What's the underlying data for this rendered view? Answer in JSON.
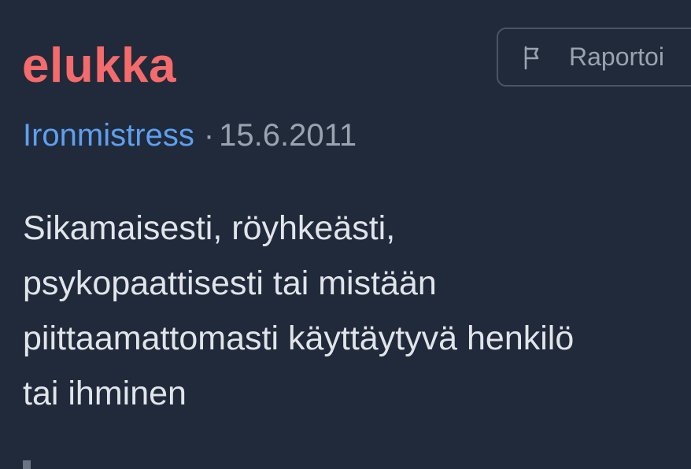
{
  "entry": {
    "word": "elukka",
    "author": "Ironmistress",
    "separator": "·",
    "date": "15.6.2011",
    "definition_lines": [
      "Sikamaisesti, röyhkeästi,",
      "psykopaattisesti tai mistään",
      "piittaamattomasti käyttäytyvä henkilö",
      "tai ihminen"
    ]
  },
  "report": {
    "label": "Raportoi",
    "icon": "flag-icon"
  },
  "colors": {
    "background": "#212a3a",
    "word": "#f56b6b",
    "author_link": "#5da0f0",
    "muted_text": "#9aa3b0",
    "body_text": "#e1e5ea",
    "button_border": "#4a5465"
  }
}
